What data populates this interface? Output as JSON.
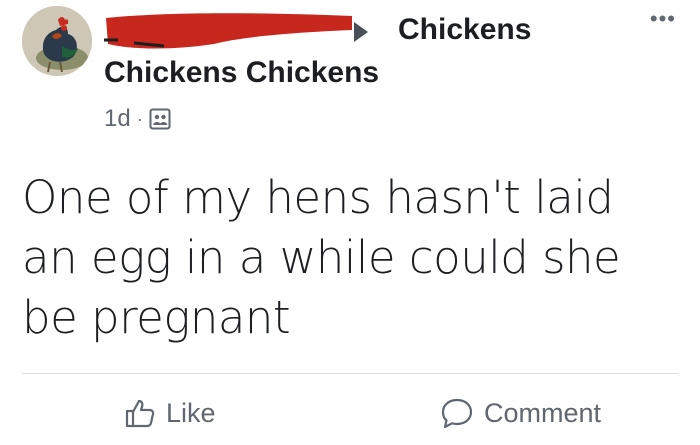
{
  "post": {
    "group_name": "Chickens",
    "poster_line": "Chickens Chickens",
    "time": "1d",
    "separator": "·",
    "text": "One of my hens hasn't laid an egg in a while could she be pregnant"
  },
  "menu": {
    "more_label": "•••"
  },
  "actions": {
    "like_label": "Like",
    "comment_label": "Comment"
  },
  "colors": {
    "redaction": "#c8271d",
    "secondary_text": "#606770",
    "divider": "#dadde1"
  },
  "icons": [
    "rooster-avatar",
    "share-arrow-icon",
    "group-icon",
    "more-icon",
    "like-icon",
    "comment-icon"
  ]
}
